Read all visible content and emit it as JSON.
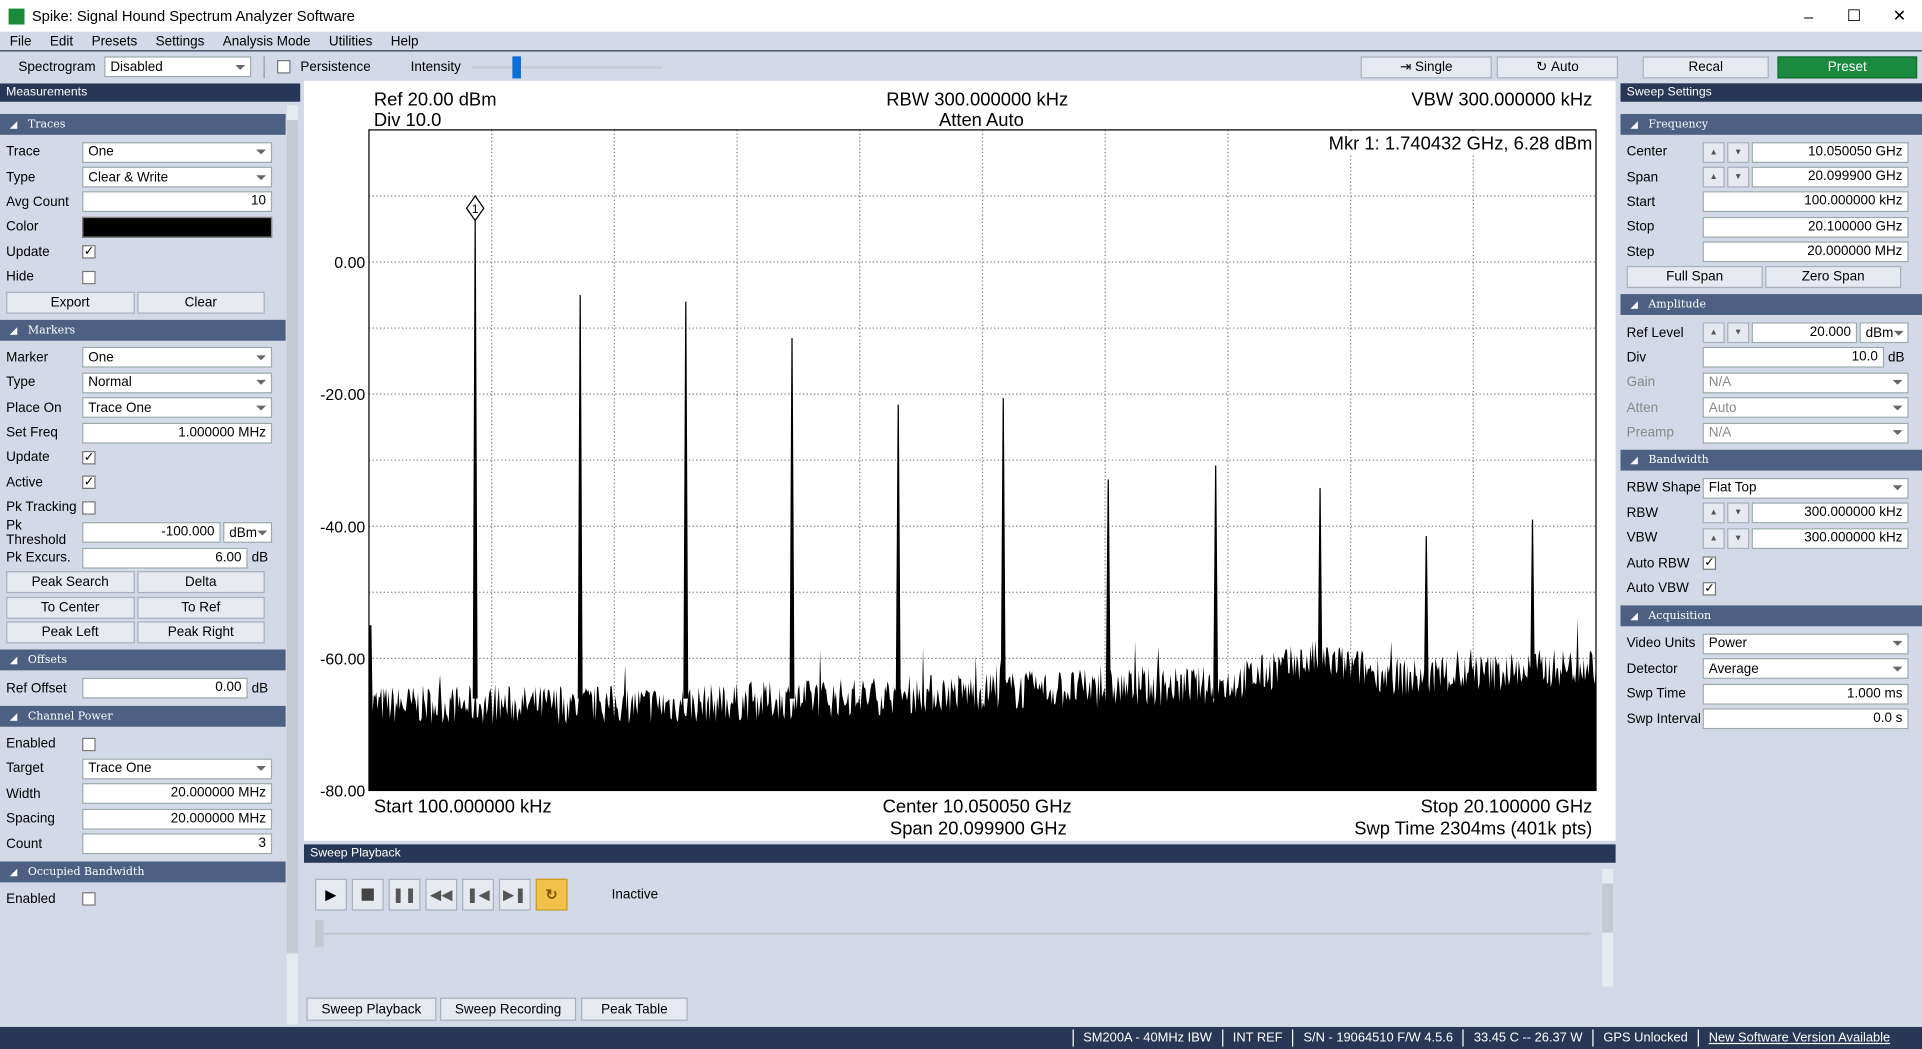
{
  "window": {
    "title": "Spike: Signal Hound Spectrum Analyzer Software"
  },
  "menu": [
    "File",
    "Edit",
    "Presets",
    "Settings",
    "Analysis Mode",
    "Utilities",
    "Help"
  ],
  "toolbar": {
    "spectrogram_label": "Spectrogram",
    "spectrogram_value": "Disabled",
    "persistence_label": "Persistence",
    "persistence_checked": false,
    "intensity_label": "Intensity",
    "intensity_level": 0.21,
    "single_label": "Single",
    "auto_label": "Auto",
    "recal_label": "Recal",
    "preset_label": "Preset",
    "preset_color": "#1a8a3e"
  },
  "left": {
    "title": "Measurements",
    "sections": [
      {
        "title": "Traces",
        "rows": [
          {
            "t": "select",
            "label": "Trace",
            "value": "One"
          },
          {
            "t": "select",
            "label": "Type",
            "value": "Clear & Write"
          },
          {
            "t": "input",
            "label": "Avg Count",
            "value": "10"
          },
          {
            "t": "color",
            "label": "Color",
            "value": "#000000"
          },
          {
            "t": "check",
            "label": "Update",
            "checked": true
          },
          {
            "t": "check",
            "label": "Hide",
            "checked": false
          },
          {
            "t": "buttons",
            "labels": [
              "Export",
              "Clear"
            ]
          }
        ]
      },
      {
        "title": "Markers",
        "rows": [
          {
            "t": "select",
            "label": "Marker",
            "value": "One"
          },
          {
            "t": "select",
            "label": "Type",
            "value": "Normal"
          },
          {
            "t": "select",
            "label": "Place On",
            "value": "Trace One"
          },
          {
            "t": "input",
            "label": "Set Freq",
            "value": "1.000000 MHz"
          },
          {
            "t": "check",
            "label": "Update",
            "checked": true
          },
          {
            "t": "check",
            "label": "Active",
            "checked": true
          },
          {
            "t": "check",
            "label": "Pk Tracking",
            "checked": false
          },
          {
            "t": "inputsel",
            "label": "Pk Threshold",
            "value": "-100.000",
            "unit": "dBm"
          },
          {
            "t": "input",
            "label": "Pk Excurs.",
            "value": "6.00",
            "unit": "dB"
          },
          {
            "t": "buttons",
            "labels": [
              "Peak Search",
              "Delta"
            ]
          },
          {
            "t": "buttons",
            "labels": [
              "To Center",
              "To Ref"
            ]
          },
          {
            "t": "buttons",
            "labels": [
              "Peak Left",
              "Peak Right"
            ]
          }
        ]
      },
      {
        "title": "Offsets",
        "rows": [
          {
            "t": "input",
            "label": "Ref Offset",
            "value": "0.00",
            "unit": "dB"
          }
        ]
      },
      {
        "title": "Channel Power",
        "rows": [
          {
            "t": "check",
            "label": "Enabled",
            "checked": false
          },
          {
            "t": "select",
            "label": "Target",
            "value": "Trace One"
          },
          {
            "t": "input",
            "label": "Width",
            "value": "20.000000 MHz"
          },
          {
            "t": "input",
            "label": "Spacing",
            "value": "20.000000 MHz"
          },
          {
            "t": "input",
            "label": "Count",
            "value": "3"
          }
        ]
      },
      {
        "title": "Occupied Bandwidth",
        "rows": [
          {
            "t": "check",
            "label": "Enabled",
            "checked": false
          }
        ]
      }
    ]
  },
  "right": {
    "title": "Sweep Settings",
    "sections": [
      {
        "title": "Frequency",
        "rows": [
          {
            "t": "stepper",
            "label": "Center",
            "value": "10.050050 GHz"
          },
          {
            "t": "stepper",
            "label": "Span",
            "value": "20.099900 GHz"
          },
          {
            "t": "input",
            "label": "Start",
            "value": "100.000000 kHz"
          },
          {
            "t": "input",
            "label": "Stop",
            "value": "20.100000 GHz"
          },
          {
            "t": "input",
            "label": "Step",
            "value": "20.000000 MHz"
          },
          {
            "t": "buttons",
            "labels": [
              "Full Span",
              "Zero Span"
            ]
          }
        ]
      },
      {
        "title": "Amplitude",
        "rows": [
          {
            "t": "stepsel",
            "label": "Ref Level",
            "value": "20.000",
            "unit": "dBm"
          },
          {
            "t": "input",
            "label": "Div",
            "value": "10.0",
            "unit": "dB"
          },
          {
            "t": "select",
            "label": "Gain",
            "value": "N/A",
            "disabled": true
          },
          {
            "t": "select",
            "label": "Atten",
            "value": "Auto",
            "disabled": true
          },
          {
            "t": "select",
            "label": "Preamp",
            "value": "N/A",
            "disabled": true
          }
        ]
      },
      {
        "title": "Bandwidth",
        "rows": [
          {
            "t": "select",
            "label": "RBW Shape",
            "value": "Flat Top"
          },
          {
            "t": "stepper",
            "label": "RBW",
            "value": "300.000000 kHz"
          },
          {
            "t": "stepper",
            "label": "VBW",
            "value": "300.000000 kHz"
          },
          {
            "t": "check",
            "label": "Auto RBW",
            "checked": true
          },
          {
            "t": "check",
            "label": "Auto VBW",
            "checked": true
          }
        ]
      },
      {
        "title": "Acquisition",
        "rows": [
          {
            "t": "select",
            "label": "Video Units",
            "value": "Power"
          },
          {
            "t": "select",
            "label": "Detector",
            "value": "Average"
          },
          {
            "t": "input",
            "label": "Swp Time",
            "value": "1.000 ms"
          },
          {
            "t": "input",
            "label": "Swp Interval",
            "value": "0.0 s"
          }
        ]
      }
    ]
  },
  "plot": {
    "ref": "Ref 20.00 dBm",
    "div": "Div 10.0",
    "rbw": "RBW 300.000000 kHz",
    "atten": "Atten Auto",
    "vbw": "VBW 300.000000 kHz",
    "marker": "Mkr 1: 1.740432 GHz, 6.28 dBm",
    "marker_id": "1",
    "start": "Start 100.000000 kHz",
    "center": "Center 10.050050 GHz",
    "span": "Span 20.099900 GHz",
    "stop": "Stop 20.100000 GHz",
    "swp": "Swp Time 2304ms (401k pts)"
  },
  "chart_data": {
    "type": "line",
    "xlabel": "",
    "ylabel": "",
    "xlim_ghz": [
      0.0001,
      20.1
    ],
    "ylim": [
      -80,
      20
    ],
    "yticks": [
      "0.00",
      "-20.00",
      "-40.00",
      "-60.00",
      "-80.00"
    ],
    "grid": true,
    "peaks": [
      {
        "f": 1.74,
        "dbm": 6.28
      },
      {
        "f": 3.46,
        "dbm": -5
      },
      {
        "f": 5.19,
        "dbm": -6
      },
      {
        "f": 6.93,
        "dbm": -11.5
      },
      {
        "f": 8.67,
        "dbm": -21.6
      },
      {
        "f": 10.39,
        "dbm": -20.6
      },
      {
        "f": 12.11,
        "dbm": -32.9
      },
      {
        "f": 13.87,
        "dbm": -30.8
      },
      {
        "f": 15.58,
        "dbm": -34.2
      },
      {
        "f": 17.32,
        "dbm": -41.5
      },
      {
        "f": 19.06,
        "dbm": -39
      }
    ],
    "noise_floor": [
      {
        "f": 0,
        "dbm": -67
      },
      {
        "f": 5,
        "dbm": -67
      },
      {
        "f": 10,
        "dbm": -65
      },
      {
        "f": 14,
        "dbm": -64
      },
      {
        "f": 15.5,
        "dbm": -60
      },
      {
        "f": 17,
        "dbm": -63
      },
      {
        "f": 20.1,
        "dbm": -61
      }
    ],
    "trace_color": "#000000"
  },
  "playback": {
    "title": "Sweep Playback",
    "state": "Inactive"
  },
  "tabs": [
    "Sweep Playback",
    "Sweep Recording",
    "Peak Table"
  ],
  "status": [
    "SM200A - 40MHz IBW",
    "INT REF",
    "S/N - 19064510   F/W 4.5.6",
    "33.45 C  --  26.37 W",
    "GPS Unlocked",
    "New Software Version Available"
  ]
}
